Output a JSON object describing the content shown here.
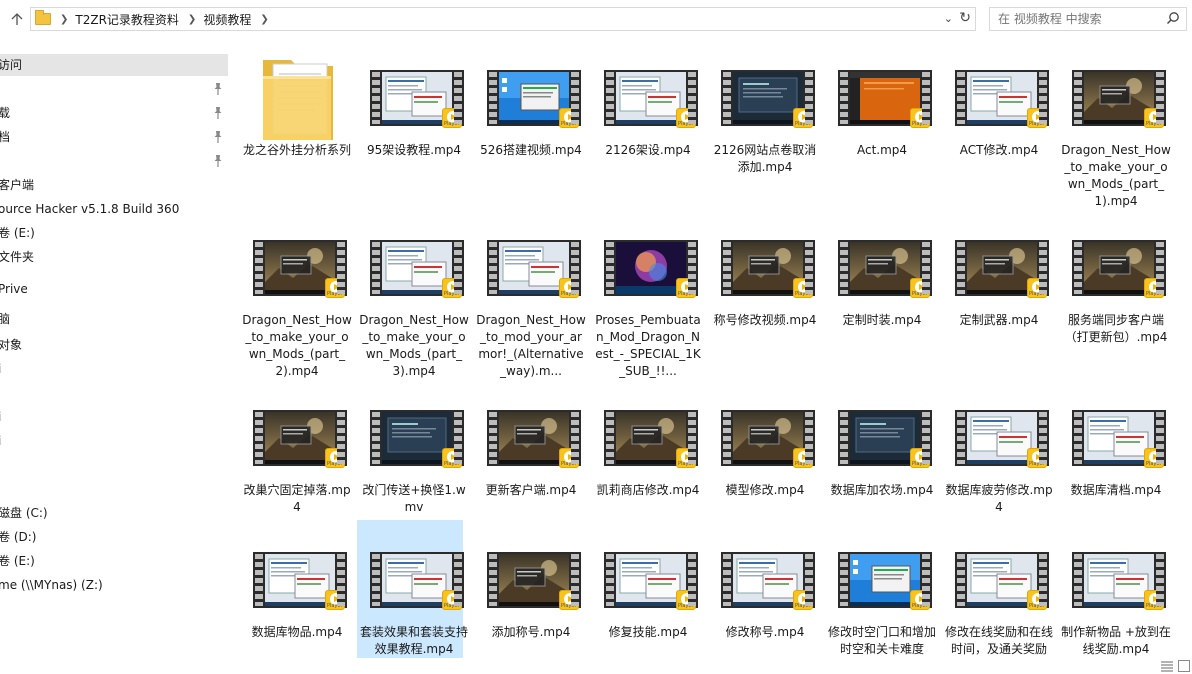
{
  "address_bar": {
    "breadcrumbs": [
      "T2ZR记录教程资料",
      "视频教程"
    ],
    "search_placeholder": "在 视频教程 中搜索"
  },
  "nav": {
    "items": [
      {
        "label": "访问",
        "selected": true
      },
      {
        "label": "",
        "pinned": true
      },
      {
        "label": "载",
        "pinned": true
      },
      {
        "label": "档",
        "pinned": true
      },
      {
        "label": "",
        "pinned": true
      },
      {
        "label": "客户端"
      },
      {
        "label": "ource Hacker v5.1.8 Build 360"
      },
      {
        "label": "卷 (E:)"
      },
      {
        "label": "文件夹"
      },
      {
        "label": "Prive"
      },
      {
        "label": "脑"
      },
      {
        "label": "对象"
      },
      {
        "label": "i"
      },
      {
        "label": ""
      },
      {
        "label": "i"
      },
      {
        "label": "i"
      },
      {
        "label": ""
      },
      {
        "label": ""
      },
      {
        "label": "磁盘 (C:)"
      },
      {
        "label": "卷 (D:)"
      },
      {
        "label": "卷 (E:)"
      },
      {
        "label": "me (\\\\MYnas) (Z:)"
      }
    ]
  },
  "badge_label": "Player",
  "files": [
    {
      "name": "龙之谷外挂分析系列",
      "type": "folder"
    },
    {
      "name": "95架设教程.mp4",
      "theme": "win"
    },
    {
      "name": "526搭建视频.mp4",
      "theme": "desktop"
    },
    {
      "name": "2126架设.mp4",
      "theme": "win"
    },
    {
      "name": "2126网站点卷取消添加.mp4",
      "theme": "dark"
    },
    {
      "name": "Act.mp4",
      "theme": "orange"
    },
    {
      "name": "ACT修改.mp4",
      "theme": "win"
    },
    {
      "name": "Dragon_Nest_How_to_make_your_own_Mods_(part_1).mp4",
      "theme": "game"
    },
    {
      "name": "Dragon_Nest_How_to_make_your_own_Mods_(part_2).mp4",
      "theme": "game"
    },
    {
      "name": "Dragon_Nest_How_to_make_your_own_Mods_(part_3).mp4",
      "theme": "win"
    },
    {
      "name": "Dragon_Nest_How_to_mod_your_armor!_(Alternative_way).m...",
      "theme": "win"
    },
    {
      "name": "Proses_Pembuatan_Mod_Dragon_Nest_-_SPECIAL_1K_SUB_!!...",
      "theme": "galaxy"
    },
    {
      "name": "称号修改视频.mp4",
      "theme": "game"
    },
    {
      "name": "定制时装.mp4",
      "theme": "game"
    },
    {
      "name": "定制武器.mp4",
      "theme": "game"
    },
    {
      "name": "服务端同步客户端（打更新包）.mp4",
      "theme": "game"
    },
    {
      "name": "改巢穴固定掉落.mp4",
      "theme": "game"
    },
    {
      "name": "改门传送+换怪1.wmv",
      "theme": "dark"
    },
    {
      "name": "更新客户端.mp4",
      "theme": "game"
    },
    {
      "name": "凯莉商店修改.mp4",
      "theme": "game"
    },
    {
      "name": "模型修改.mp4",
      "theme": "game"
    },
    {
      "name": "数据库加农场.mp4",
      "theme": "dark"
    },
    {
      "name": "数据库疲劳修改.mp4",
      "theme": "win"
    },
    {
      "name": "数据库清档.mp4",
      "theme": "win"
    },
    {
      "name": "数据库物品.mp4",
      "theme": "win"
    },
    {
      "name": "套装效果和套装支持效果教程.mp4",
      "theme": "win",
      "selected": true
    },
    {
      "name": "添加称号.mp4",
      "theme": "game"
    },
    {
      "name": "修复技能.mp4",
      "theme": "win"
    },
    {
      "name": "修改称号.mp4",
      "theme": "win"
    },
    {
      "name": "修改时空门口和增加时空和关卡难度",
      "theme": "desktop"
    },
    {
      "name": "修改在线奖励和在线时间，及通关奖励",
      "theme": "win"
    },
    {
      "name": "制作新物品 +放到在线奖励.mp4",
      "theme": "win"
    }
  ]
}
